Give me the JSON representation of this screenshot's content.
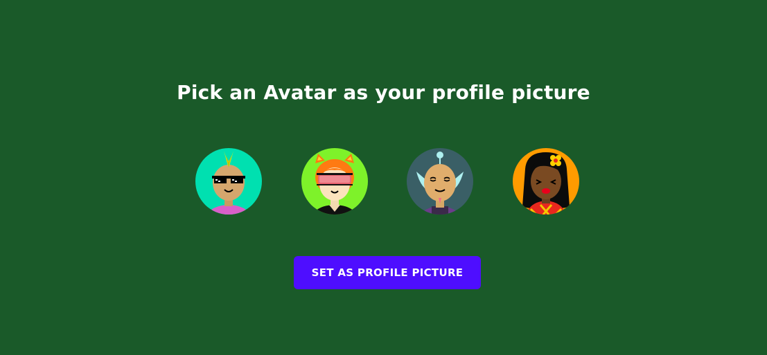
{
  "title": "Pick an Avatar as your profile picture",
  "avatars": [
    {
      "name": "avatar-mohawk-sunglasses",
      "background": "#00e0b0"
    },
    {
      "name": "avatar-redhead-visor",
      "background": "#7ef22a"
    },
    {
      "name": "avatar-bald-antenna",
      "background": "#3a5f66"
    },
    {
      "name": "avatar-woman-flower",
      "background": "#ff9b00"
    }
  ],
  "button": {
    "label": "SET AS PROFILE PICTURE",
    "color": "#4e0eff"
  },
  "colors": {
    "background": "#1a5a29",
    "text": "#ffffff"
  }
}
